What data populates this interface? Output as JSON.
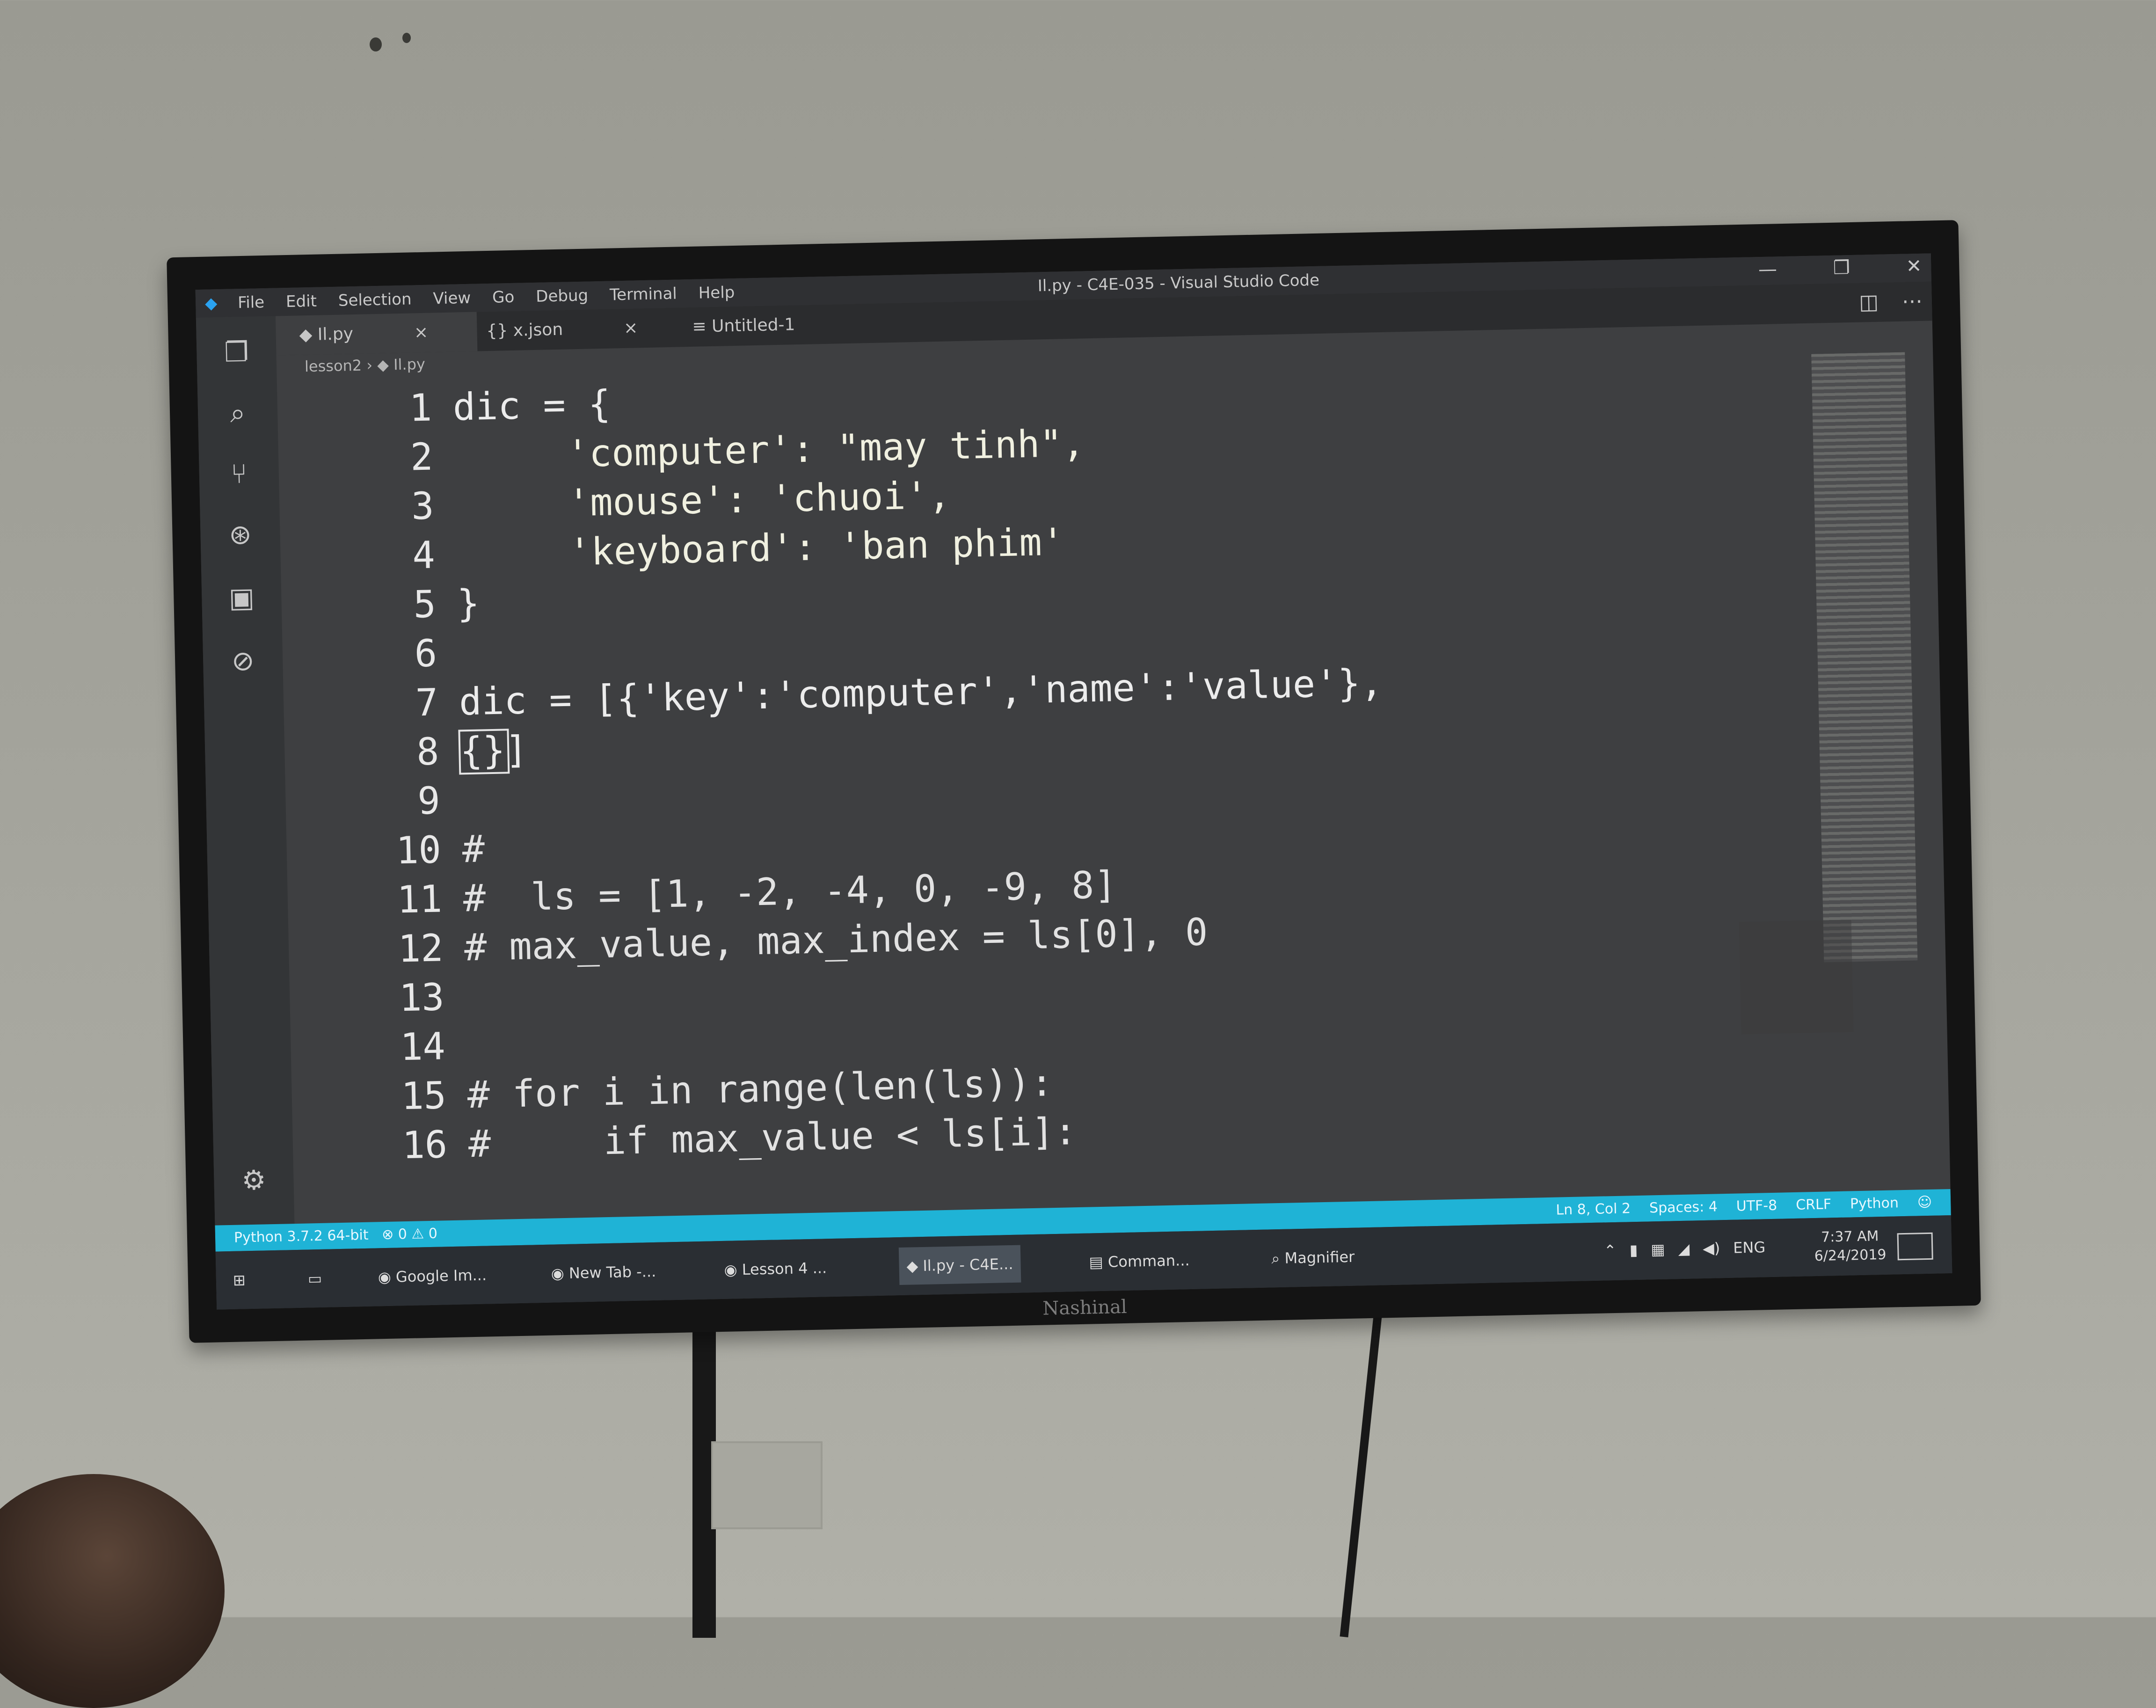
{
  "window": {
    "title": "Il.py - C4E-035 - Visual Studio Code",
    "menu": [
      "File",
      "Edit",
      "Selection",
      "View",
      "Go",
      "Debug",
      "Terminal",
      "Help"
    ],
    "controls": [
      "—",
      "❐",
      "✕"
    ]
  },
  "tabs": [
    {
      "label": "Il.py",
      "icon": "python-file-icon",
      "close": "×"
    },
    {
      "label": "x.json",
      "icon": "json-file-icon",
      "close": "×"
    },
    {
      "label": "Untitled-1",
      "icon": "text-file-icon"
    }
  ],
  "breadcrumb": {
    "folder": "lesson2",
    "file": "Il.py"
  },
  "code_lines": [
    {
      "n": "1",
      "text": "dic = {"
    },
    {
      "n": "2",
      "text": "     'computer': \"may tinh\","
    },
    {
      "n": "3",
      "text": "     'mouse': 'chuoi',"
    },
    {
      "n": "4",
      "text": "     'keyboard': 'ban phim'"
    },
    {
      "n": "5",
      "text": "}"
    },
    {
      "n": "6",
      "text": ""
    },
    {
      "n": "7",
      "text": "dic = [{'key':'computer','name':'value'},"
    },
    {
      "n": "8",
      "text": "{}]"
    },
    {
      "n": "9",
      "text": ""
    },
    {
      "n": "10",
      "text": "#"
    },
    {
      "n": "11",
      "text": "#  ls = [1, -2, -4, 0, -9, 8]"
    },
    {
      "n": "12",
      "text": "# max_value, max_index = ls[0], 0"
    },
    {
      "n": "13",
      "text": ""
    },
    {
      "n": "14",
      "text": ""
    },
    {
      "n": "15",
      "text": "# for i in range(len(ls)):"
    },
    {
      "n": "16",
      "text": "#     if max_value < ls[i]:"
    }
  ],
  "status": {
    "interpreter": "Python 3.7.2 64-bit",
    "problems": "⊗ 0 ⚠ 0",
    "position": "Ln 8, Col 2",
    "indent": "Spaces: 4",
    "encoding": "UTF-8",
    "eol": "CRLF",
    "language": "Python"
  },
  "taskbar": {
    "items": [
      {
        "label": "Google Im...",
        "icon": "chrome-icon"
      },
      {
        "label": "New Tab -...",
        "icon": "chrome-icon"
      },
      {
        "label": "Lesson 4 ...",
        "icon": "chrome-icon"
      },
      {
        "label": "Il.py - C4E...",
        "icon": "vscode-icon"
      },
      {
        "label": "Comman...",
        "icon": "terminal-icon"
      },
      {
        "label": "Magnifier",
        "icon": "magnifier-icon"
      }
    ],
    "lang": "ENG",
    "time": "7:37 AM",
    "date": "6/24/2019"
  },
  "tv_brand": "Nashinal"
}
